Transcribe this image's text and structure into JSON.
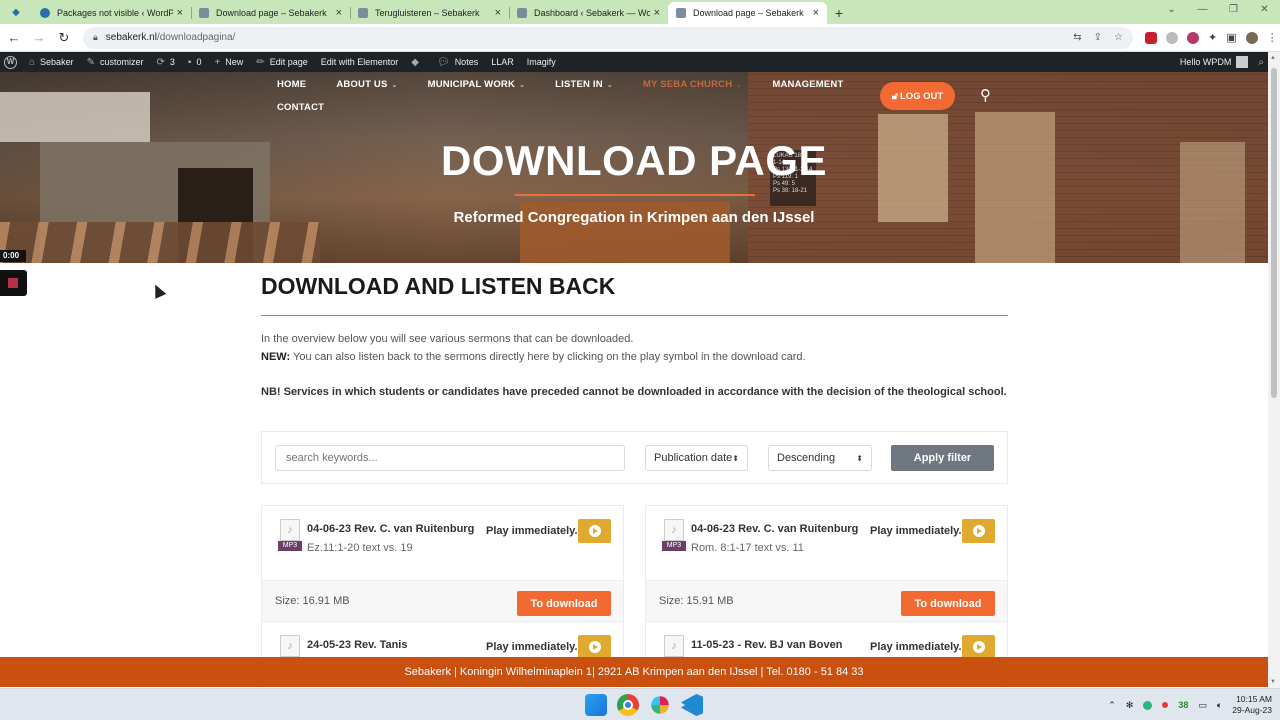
{
  "browser": {
    "tabs": [
      {
        "title": "Packages not visible ‹ WordPress",
        "active": false
      },
      {
        "title": "Download page – Sebakerk",
        "active": false
      },
      {
        "title": "Terugluisteren – Sebakerk",
        "active": false
      },
      {
        "title": "Dashboard ‹ Sebakerk — WordPress",
        "active": false
      },
      {
        "title": "Download page – Sebakerk",
        "active": true
      }
    ],
    "url_domain": "sebakerk.nl",
    "url_path": "/downloadpagina/"
  },
  "adminbar": {
    "site": "Sebaker",
    "customizer": "customizer",
    "updates": "3",
    "comments": "0",
    "new": "New",
    "edit_page": "Edit page",
    "elementor": "Edit with Elementor",
    "notes": "Notes",
    "llar": "LLAR",
    "imagify": "Imagify",
    "greeting": "Hello WPDM"
  },
  "nav": {
    "row1": [
      {
        "label": "HOME",
        "dropdown": false,
        "highlight": false
      },
      {
        "label": "ABOUT US",
        "dropdown": true,
        "highlight": false
      },
      {
        "label": "MUNICIPAL WORK",
        "dropdown": true,
        "highlight": false
      },
      {
        "label": "LISTEN IN",
        "dropdown": true,
        "highlight": false
      },
      {
        "label": "MY SEBA CHURCH",
        "dropdown": true,
        "highlight": true
      },
      {
        "label": "MANAGEMENT",
        "dropdown": false,
        "highlight": false
      }
    ],
    "row2": [
      {
        "label": "CONTACT"
      }
    ],
    "logout": "LOG OUT"
  },
  "hero": {
    "title": "DOWNLOAD PAGE",
    "subtitle": "Reformed Congregation in Krimpen aan den IJssel",
    "hymn_board": "LUKAS 18:\n1-14\nPs 139: 1-2-14\nPs 119: 1\nPs 49: 5\nPs 38: 18-21"
  },
  "video": {
    "time": "0:00"
  },
  "content": {
    "heading": "DOWNLOAD AND LISTEN BACK",
    "p1": "In the overview below you will see various sermons that can be downloaded.",
    "p2_label": "NEW:",
    "p2_text": " You can also listen back to the sermons directly here by clicking on the play symbol in the download card.",
    "p3": "NB! Services in which students or candidates have preceded cannot be downloaded in accordance with the decision of the theological school."
  },
  "filter": {
    "search_placeholder": "search keywords...",
    "sort_by": "Publication date",
    "order": "Descending",
    "apply": "Apply filter"
  },
  "cards": [
    {
      "title": "04-06-23 Rev. C. van Ruitenburg",
      "sub": "Ez.11:1-20 text vs. 19",
      "size": "Size: 16.91 MB"
    },
    {
      "title": "04-06-23 Rev. C. van Ruitenburg",
      "sub": "Rom. 8:1-17 text vs. 11",
      "size": "Size: 15.91 MB"
    },
    {
      "title": "24-05-23 Rev. Tanis",
      "sub": "",
      "size": ""
    },
    {
      "title": "11-05-23 - Rev. BJ van Boven",
      "sub": "",
      "size": ""
    }
  ],
  "card_labels": {
    "badge": "MP3",
    "play": "Play immediately.",
    "download": "To download"
  },
  "footer": "Sebakerk | Koningin Wilhelminaplein 1| 2921 AB Krimpen aan den IJssel | Tel. 0180 - 51 84 33",
  "taskbar": {
    "time": "10:15 AM",
    "date": "29-Aug-23",
    "tray_count": "38"
  }
}
